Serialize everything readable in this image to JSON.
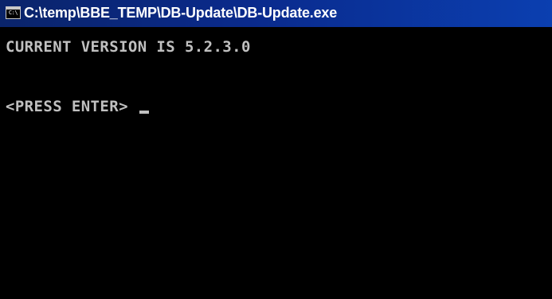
{
  "window": {
    "title": "C:\\temp\\BBE_TEMP\\DB-Update\\DB-Update.exe",
    "icon": "console-window-icon",
    "icon_glyph": "C:\\"
  },
  "console": {
    "lines": [
      "CURRENT VERSION IS 5.2.3.0",
      "<PRESS ENTER> "
    ],
    "text_color": "#c0c0c0",
    "background_color": "#000000"
  },
  "colors": {
    "titlebar": "#0a246a",
    "title_text": "#ffffff"
  }
}
